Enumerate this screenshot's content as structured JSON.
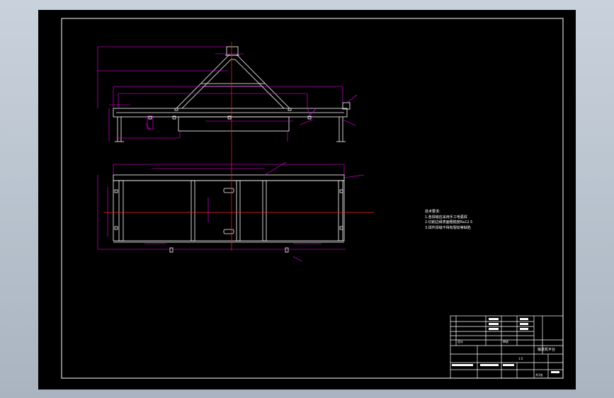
{
  "notes": {
    "title": "技术要求:",
    "items": [
      "1.各焊缝应采用手工电弧焊",
      "2.切削边缘表面粗糙度Ra12.5",
      "3.焊件焊缝不得有裂纹等缺陷"
    ]
  },
  "title_block": {
    "drawing_name": "输送机平台",
    "designer": "设计",
    "checker": "审核",
    "scale": "1:5",
    "sheet": "共1张"
  },
  "colors": {
    "background": "#000000",
    "frame": "#ffffff",
    "part_outline": "#ffffff",
    "dimension": "#ff00ff",
    "centerline": "#ff0000"
  }
}
